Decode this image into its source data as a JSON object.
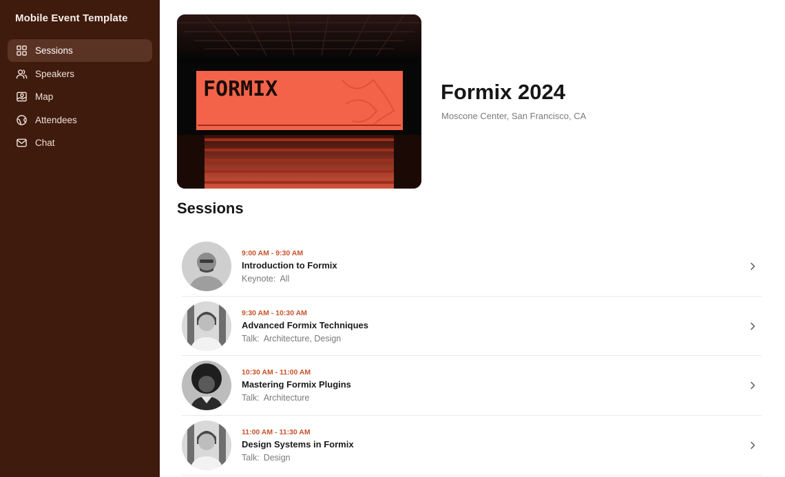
{
  "app": {
    "title": "Mobile Event Template"
  },
  "sidebar": {
    "items": [
      {
        "label": "Sessions",
        "icon": "grid-icon",
        "active": true
      },
      {
        "label": "Speakers",
        "icon": "people-icon",
        "active": false
      },
      {
        "label": "Map",
        "icon": "map-icon",
        "active": false
      },
      {
        "label": "Attendees",
        "icon": "globe-icon",
        "active": false
      },
      {
        "label": "Chat",
        "icon": "mail-icon",
        "active": false
      }
    ]
  },
  "event": {
    "title": "Formix 2024",
    "location": "Moscone Center, San Francisco, CA",
    "hero_image": {
      "screen_text": "FORMIX",
      "screen_color": "#f2634a"
    }
  },
  "sessions": {
    "heading": "Sessions",
    "items": [
      {
        "time": "9:00 AM - 9:30 AM",
        "title": "Introduction to Formix",
        "type": "Keynote:",
        "tags": "All"
      },
      {
        "time": "9:30 AM - 10:30 AM",
        "title": "Advanced Formix Techniques",
        "type": "Talk:",
        "tags": "Architecture, Design"
      },
      {
        "time": "10:30 AM - 11:00 AM",
        "title": "Mastering Formix Plugins",
        "type": "Talk:",
        "tags": "Architecture"
      },
      {
        "time": "11:00 AM - 11:30 AM",
        "title": "Design Systems in Formix",
        "type": "Talk:",
        "tags": "Design"
      }
    ]
  },
  "colors": {
    "sidebar_bg": "#3f1b0d",
    "sidebar_active": "#5a3325",
    "accent": "#c8512a"
  }
}
